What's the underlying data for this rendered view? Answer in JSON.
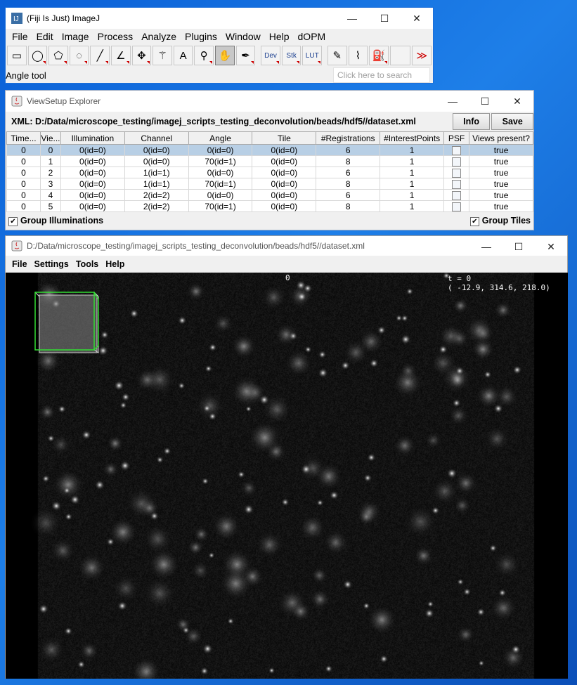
{
  "imagej": {
    "title": "(Fiji Is Just) ImageJ",
    "menu": [
      "File",
      "Edit",
      "Image",
      "Process",
      "Analyze",
      "Plugins",
      "Window",
      "Help",
      "dOPM"
    ],
    "tools": [
      {
        "name": "rectangle-icon",
        "glyph": "▭"
      },
      {
        "name": "oval-icon",
        "glyph": "◯"
      },
      {
        "name": "polygon-icon",
        "glyph": "⬠"
      },
      {
        "name": "freehand-icon",
        "glyph": "◌"
      },
      {
        "name": "line-icon",
        "glyph": "╱"
      },
      {
        "name": "angle-icon",
        "glyph": "∠"
      },
      {
        "name": "point-icon",
        "glyph": "✥"
      },
      {
        "name": "wand-icon",
        "glyph": "⚚"
      },
      {
        "name": "text-icon",
        "glyph": "A"
      },
      {
        "name": "magnifier-icon",
        "glyph": "⚲"
      },
      {
        "name": "hand-icon",
        "glyph": "✋"
      },
      {
        "name": "dropper-icon",
        "glyph": "✒"
      },
      {
        "name": "dev-icon",
        "glyph": "Dev"
      },
      {
        "name": "stk-icon",
        "glyph": "Stk"
      },
      {
        "name": "lut-icon",
        "glyph": "LUT"
      },
      {
        "name": "pencil-icon",
        "glyph": "✎"
      },
      {
        "name": "brush-icon",
        "glyph": "⌇"
      },
      {
        "name": "flood-fill-icon",
        "glyph": "⛽"
      },
      {
        "name": "blank-tool-icon",
        "glyph": ""
      },
      {
        "name": "more-tools-icon",
        "glyph": "≫"
      }
    ],
    "status": "Angle tool",
    "search_placeholder": "Click here to search"
  },
  "explorer": {
    "title": "ViewSetup Explorer",
    "xml_label": "XML: D:/Data/microscope_testing/imagej_scripts_testing_deconvolution/beads/hdf5//dataset.xml",
    "info_label": "Info",
    "save_label": "Save",
    "columns": [
      "Time...",
      "Vie...",
      "Illumination",
      "Channel",
      "Angle",
      "Tile",
      "#Registrations",
      "#InterestPoints",
      "PSF",
      "Views present?"
    ],
    "rows": [
      [
        "0",
        "0",
        "0(id=0)",
        "0(id=0)",
        "0(id=0)",
        "0(id=0)",
        "6",
        "1",
        "",
        "true"
      ],
      [
        "0",
        "1",
        "0(id=0)",
        "0(id=0)",
        "70(id=1)",
        "0(id=0)",
        "8",
        "1",
        "",
        "true"
      ],
      [
        "0",
        "2",
        "0(id=0)",
        "1(id=1)",
        "0(id=0)",
        "0(id=0)",
        "6",
        "1",
        "",
        "true"
      ],
      [
        "0",
        "3",
        "0(id=0)",
        "1(id=1)",
        "70(id=1)",
        "0(id=0)",
        "8",
        "1",
        "",
        "true"
      ],
      [
        "0",
        "4",
        "0(id=0)",
        "2(id=2)",
        "0(id=0)",
        "0(id=0)",
        "6",
        "1",
        "",
        "true"
      ],
      [
        "0",
        "5",
        "0(id=0)",
        "2(id=2)",
        "70(id=1)",
        "0(id=0)",
        "8",
        "1",
        "",
        "true"
      ]
    ],
    "selected_row": 0,
    "group_illuminations_label": "Group Illuminations",
    "group_tiles_label": "Group Tiles"
  },
  "viewer": {
    "title": "D:/Data/microscope_testing/imagej_scripts_testing_deconvolution/beads/hdf5//dataset.xml",
    "menu": [
      "File",
      "Settings",
      "Tools",
      "Help"
    ],
    "source_index": "0",
    "time_label": "t = 0",
    "coordinates": "( -12.9, 314.6, 218.0)"
  },
  "colors": {
    "desktop": "#1468d8",
    "selection": "#b8cfe5",
    "bbox_green": "#33dd33"
  }
}
